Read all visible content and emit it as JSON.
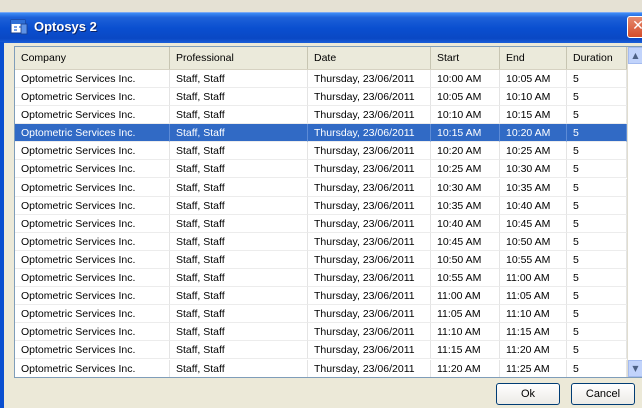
{
  "window": {
    "title": "Optosys 2",
    "close_glyph": "✕"
  },
  "columns": [
    "Company",
    "Professional",
    "Date",
    "Start",
    "End",
    "Duration"
  ],
  "selected_row": 3,
  "rows": [
    [
      "Optometric Services Inc.",
      "Staff, Staff",
      "Thursday, 23/06/2011",
      "10:00 AM",
      "10:05 AM",
      "5"
    ],
    [
      "Optometric Services Inc.",
      "Staff, Staff",
      "Thursday, 23/06/2011",
      "10:05 AM",
      "10:10 AM",
      "5"
    ],
    [
      "Optometric Services Inc.",
      "Staff, Staff",
      "Thursday, 23/06/2011",
      "10:10 AM",
      "10:15 AM",
      "5"
    ],
    [
      "Optometric Services Inc.",
      "Staff, Staff",
      "Thursday, 23/06/2011",
      "10:15 AM",
      "10:20 AM",
      "5"
    ],
    [
      "Optometric Services Inc.",
      "Staff, Staff",
      "Thursday, 23/06/2011",
      "10:20 AM",
      "10:25 AM",
      "5"
    ],
    [
      "Optometric Services Inc.",
      "Staff, Staff",
      "Thursday, 23/06/2011",
      "10:25 AM",
      "10:30 AM",
      "5"
    ],
    [
      "Optometric Services Inc.",
      "Staff, Staff",
      "Thursday, 23/06/2011",
      "10:30 AM",
      "10:35 AM",
      "5"
    ],
    [
      "Optometric Services Inc.",
      "Staff, Staff",
      "Thursday, 23/06/2011",
      "10:35 AM",
      "10:40 AM",
      "5"
    ],
    [
      "Optometric Services Inc.",
      "Staff, Staff",
      "Thursday, 23/06/2011",
      "10:40 AM",
      "10:45 AM",
      "5"
    ],
    [
      "Optometric Services Inc.",
      "Staff, Staff",
      "Thursday, 23/06/2011",
      "10:45 AM",
      "10:50 AM",
      "5"
    ],
    [
      "Optometric Services Inc.",
      "Staff, Staff",
      "Thursday, 23/06/2011",
      "10:50 AM",
      "10:55 AM",
      "5"
    ],
    [
      "Optometric Services Inc.",
      "Staff, Staff",
      "Thursday, 23/06/2011",
      "10:55 AM",
      "11:00 AM",
      "5"
    ],
    [
      "Optometric Services Inc.",
      "Staff, Staff",
      "Thursday, 23/06/2011",
      "11:00 AM",
      "11:05 AM",
      "5"
    ],
    [
      "Optometric Services Inc.",
      "Staff, Staff",
      "Thursday, 23/06/2011",
      "11:05 AM",
      "11:10 AM",
      "5"
    ],
    [
      "Optometric Services Inc.",
      "Staff, Staff",
      "Thursday, 23/06/2011",
      "11:10 AM",
      "11:15 AM",
      "5"
    ],
    [
      "Optometric Services Inc.",
      "Staff, Staff",
      "Thursday, 23/06/2011",
      "11:15 AM",
      "11:20 AM",
      "5"
    ],
    [
      "Optometric Services Inc.",
      "Staff, Staff",
      "Thursday, 23/06/2011",
      "11:20 AM",
      "11:25 AM",
      "5"
    ]
  ],
  "buttons": {
    "ok": "Ok",
    "cancel": "Cancel"
  },
  "colors": {
    "selection": "#316ac5",
    "titlebar": "#0a4fd0"
  },
  "icons": {
    "app": "calendar-icon",
    "scroll_up": "▲",
    "scroll_down": "▼"
  }
}
